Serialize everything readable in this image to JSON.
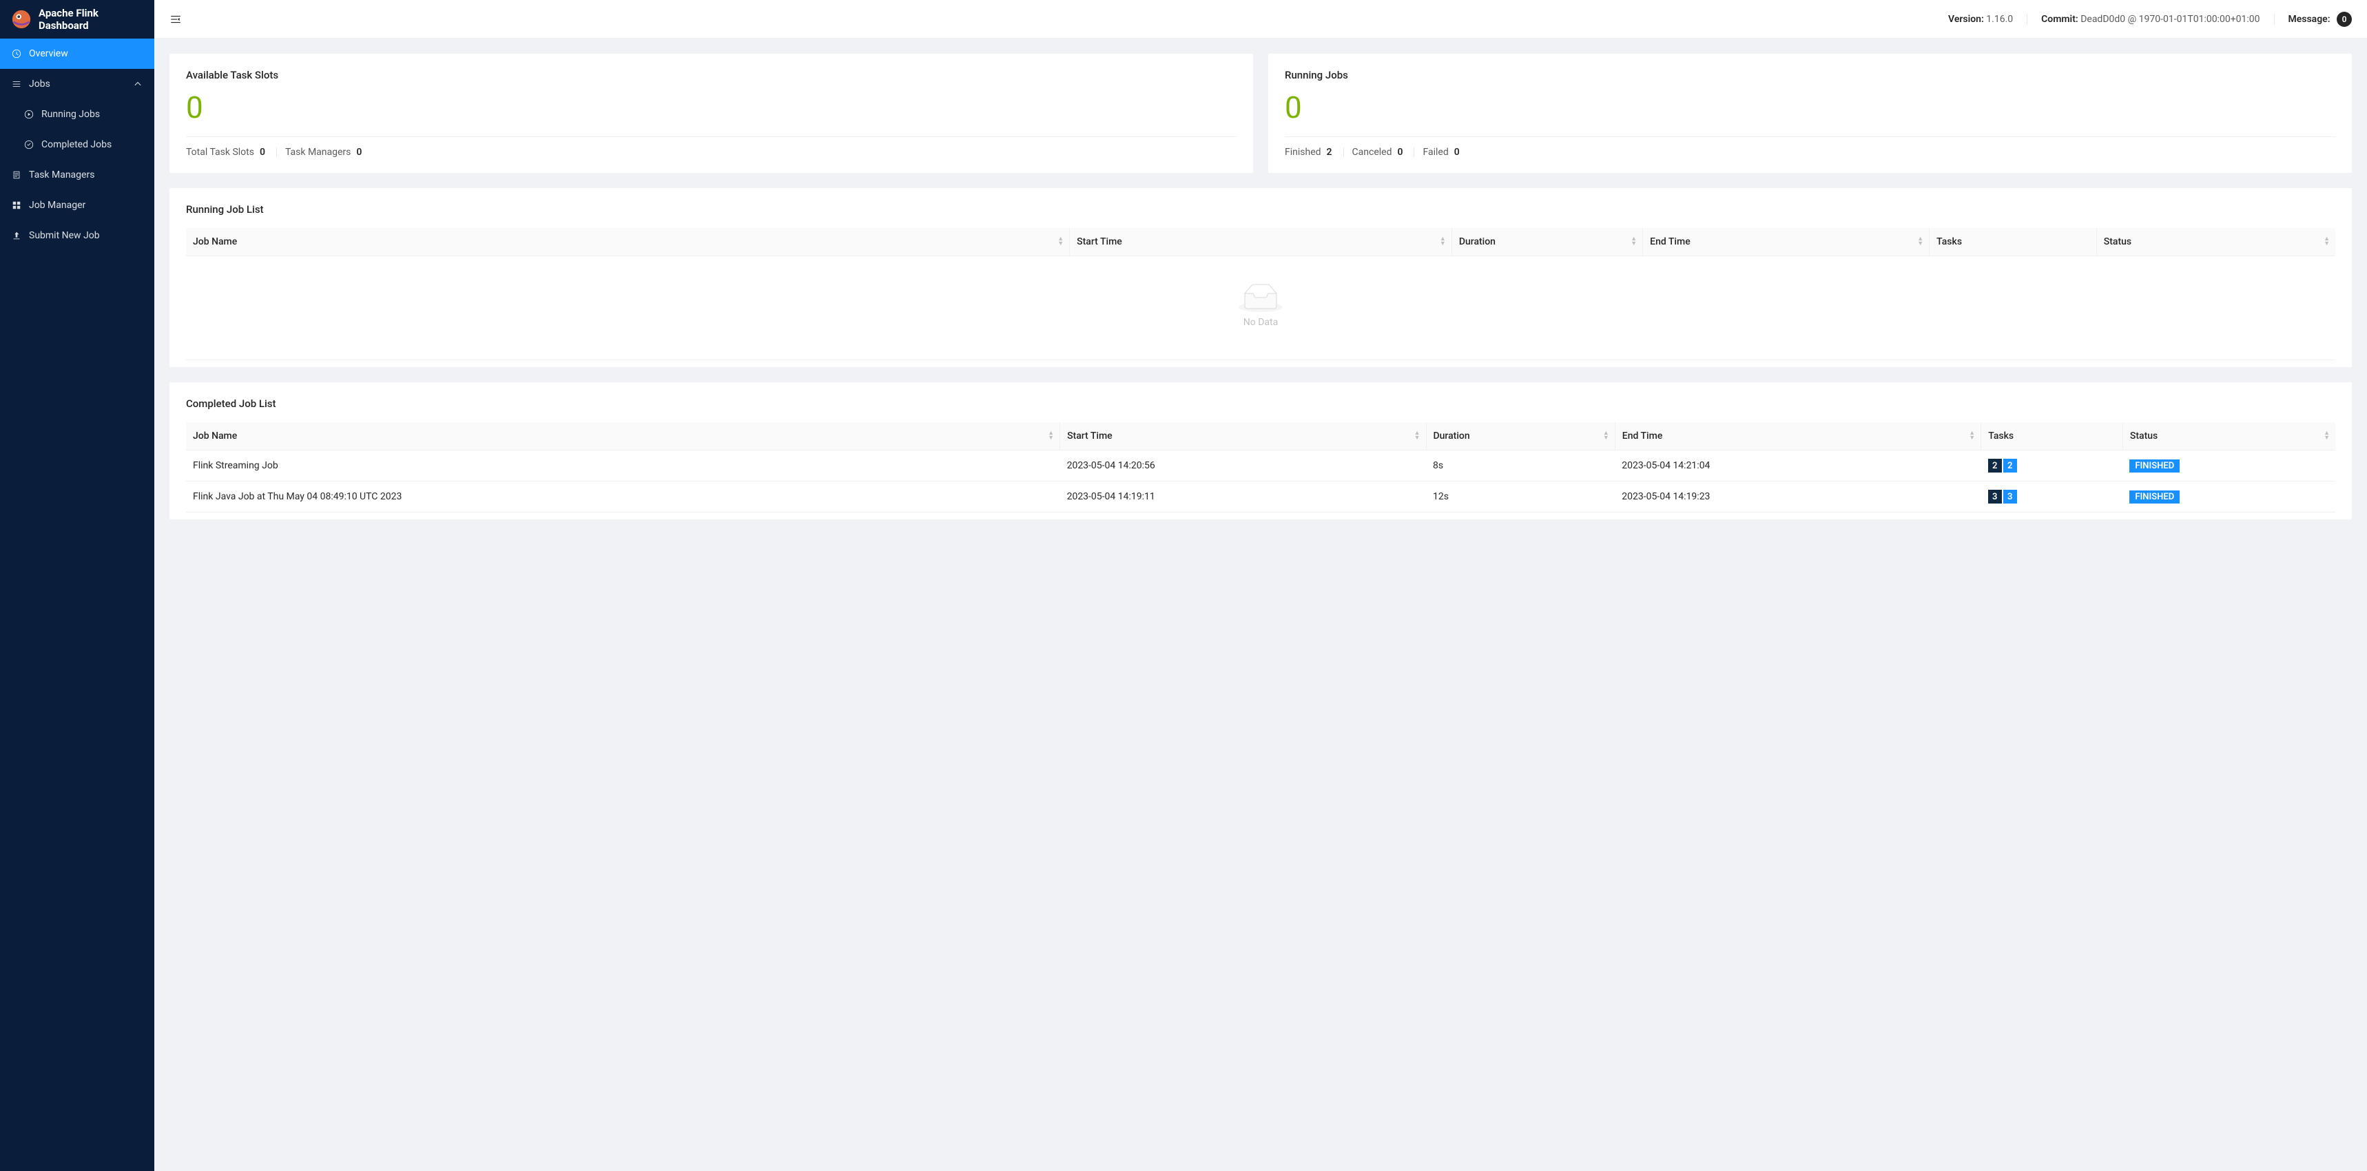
{
  "header": {
    "title": "Apache Flink Dashboard",
    "version_label": "Version:",
    "version": "1.16.0",
    "commit_label": "Commit:",
    "commit": "DeadD0d0 @ 1970-01-01T01:00:00+01:00",
    "message_label": "Message:",
    "message_count": "0"
  },
  "sidebar": {
    "overview": "Overview",
    "jobs": "Jobs",
    "running_jobs": "Running Jobs",
    "completed_jobs": "Completed Jobs",
    "task_managers": "Task Managers",
    "job_manager": "Job Manager",
    "submit_new_job": "Submit New Job"
  },
  "cards": {
    "slots": {
      "title": "Available Task Slots",
      "value": "0",
      "total_label": "Total Task Slots",
      "total": "0",
      "tm_label": "Task Managers",
      "tm": "0"
    },
    "running": {
      "title": "Running Jobs",
      "value": "0",
      "finished_label": "Finished",
      "finished": "2",
      "canceled_label": "Canceled",
      "canceled": "0",
      "failed_label": "Failed",
      "failed": "0"
    }
  },
  "running_list": {
    "title": "Running Job List",
    "empty": "No Data"
  },
  "completed_list": {
    "title": "Completed Job List",
    "rows": [
      {
        "name": "Flink Streaming Job",
        "start": "2023-05-04 14:20:56",
        "duration": "8s",
        "end": "2023-05-04 14:21:04",
        "t1": "2",
        "t2": "2",
        "status": "FINISHED"
      },
      {
        "name": "Flink Java Job at Thu May 04 08:49:10 UTC 2023",
        "start": "2023-05-04 14:19:11",
        "duration": "12s",
        "end": "2023-05-04 14:19:23",
        "t1": "3",
        "t2": "3",
        "status": "FINISHED"
      }
    ]
  },
  "columns": {
    "job_name": "Job Name",
    "start_time": "Start Time",
    "duration": "Duration",
    "end_time": "End Time",
    "tasks": "Tasks",
    "status": "Status"
  }
}
